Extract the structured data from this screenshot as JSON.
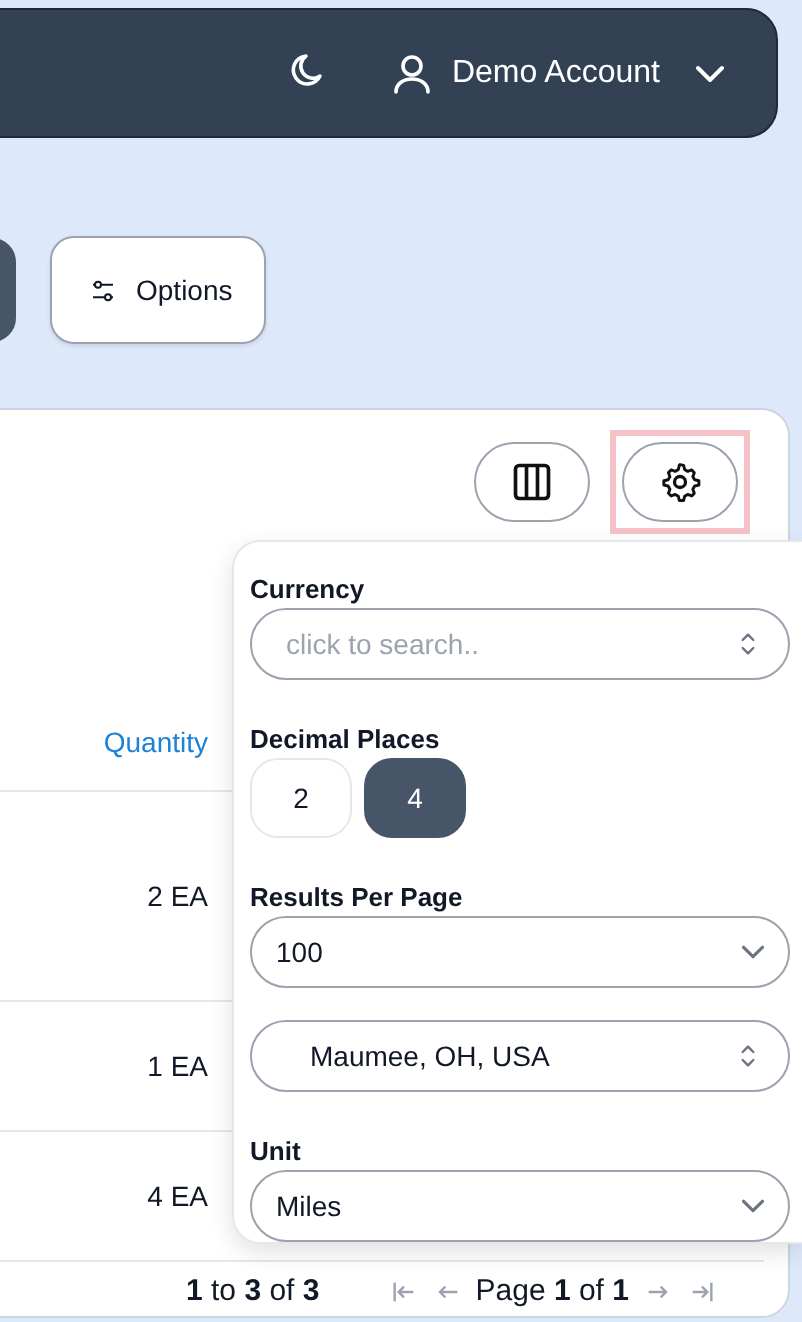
{
  "header": {
    "account_name": "Demo Account"
  },
  "toolbar": {
    "options_button": "Options"
  },
  "table": {
    "columns": [
      {
        "label": "Quantity"
      }
    ],
    "rows": [
      {
        "quantity": "2 EA"
      },
      {
        "quantity": "1 EA"
      },
      {
        "quantity": "4 EA"
      }
    ],
    "gear_button": {
      "highlighted": true
    }
  },
  "pagination": {
    "range": "**1** to **3** of **3**",
    "page": "Page **1** of **1**"
  },
  "settings_popover": {
    "currency": {
      "label": "Currency",
      "placeholder": "click to search.."
    },
    "decimal_places": {
      "label": "Decimal Places",
      "options": [
        {
          "label": "2",
          "selected": false
        },
        {
          "label": "4",
          "selected": true
        }
      ]
    },
    "results_per_page": {
      "label": "Results Per Page",
      "value": "100"
    },
    "location": {
      "value": "Maumee, OH, USA"
    },
    "unit": {
      "label": "Unit",
      "value": "Miles"
    }
  }
}
